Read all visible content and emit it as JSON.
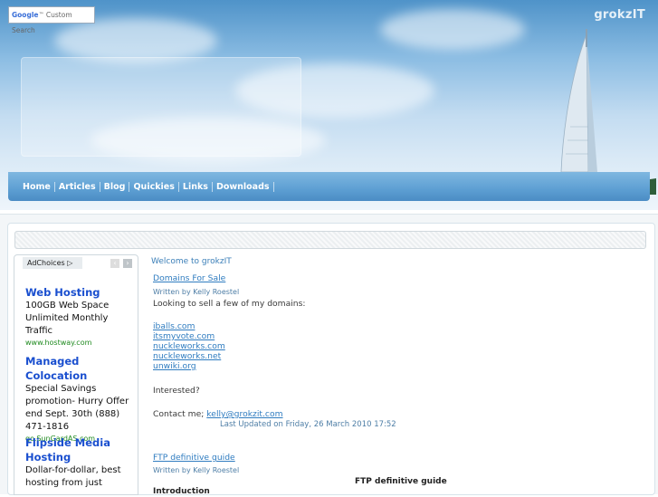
{
  "header": {
    "search_box": "Google™ Custom Search",
    "search_brand": "Google",
    "search_suffix": "Custom Search",
    "site_name": "grokzIT",
    "nav": [
      "Home",
      "Articles",
      "Blog",
      "Quickies",
      "Links",
      "Downloads"
    ]
  },
  "ads": {
    "adchoices": "AdChoices",
    "items": [
      {
        "title": "Web Hosting",
        "desc": "100GB Web Space Unlimited Monthly Traffic",
        "url": "www.hostway.com"
      },
      {
        "title": "Managed Colocation",
        "desc": "Special Savings promotion- Hurry Offer end Sept. 30th (888) 471-1816",
        "url": "go.SunGardAS.com"
      },
      {
        "title": "Flipside Media Hosting",
        "desc": "Dollar-for-dollar, best hosting from just",
        "url": ""
      }
    ]
  },
  "main": {
    "welcome": "Welcome to grokzIT",
    "article1": {
      "title": "Domains For Sale",
      "author": "Written by Kelly Roestel",
      "intro": "Looking to sell a few of my domains:",
      "domains": [
        "iballs.com",
        "itsmyvote.com",
        "nuckleworks.com",
        "nuckleworks.net",
        "unwiki.org"
      ],
      "question": "Interested?",
      "contact_label": "Contact me;",
      "contact_email": "kelly@grokzit.com",
      "updated": "Last Updated on Friday, 26 March 2010 17:52"
    },
    "article2": {
      "title": "FTP definitive guide",
      "author": "Written by Kelly Roestel",
      "heading": "FTP definitive guide",
      "section": "Introduction"
    }
  },
  "colors": {
    "link": "#2f7cc0",
    "ad_title": "#1a4fcf",
    "ad_url": "#1f8a1f",
    "nav_bar": "#5d9fd3"
  }
}
